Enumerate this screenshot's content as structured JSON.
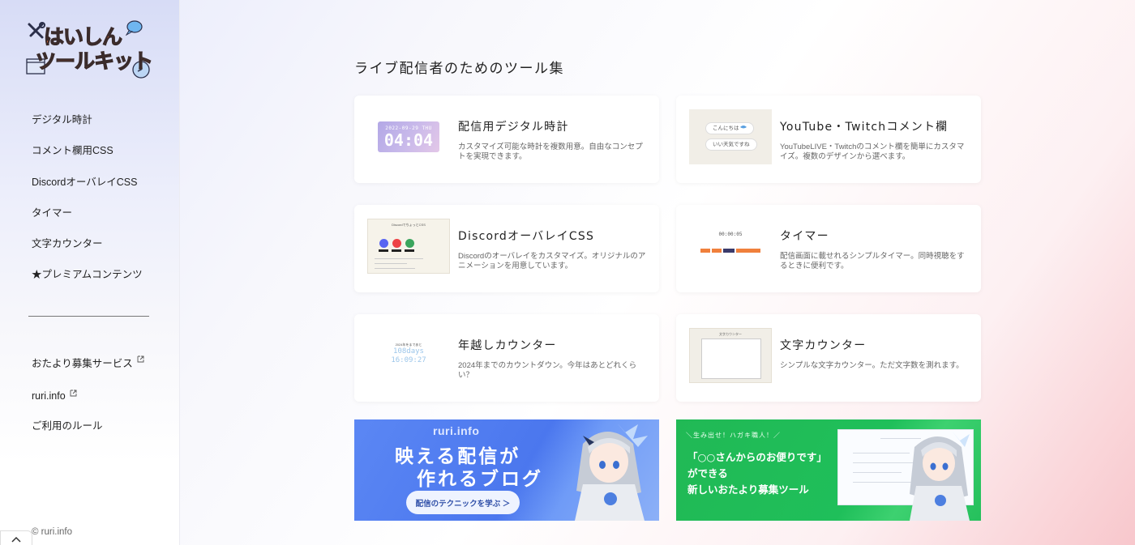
{
  "logo": {
    "line1": "はいしん",
    "line2": "ツールキット"
  },
  "sidebar": {
    "items": [
      {
        "label": "デジタル時計"
      },
      {
        "label": "コメント欄用CSS"
      },
      {
        "label": "DiscordオーバレイCSS"
      },
      {
        "label": "タイマー"
      },
      {
        "label": "文字カウンター"
      },
      {
        "label": "★プレミアムコンテンツ"
      }
    ],
    "external": [
      {
        "label": "おたより募集サービス",
        "icon": "external-link-icon"
      },
      {
        "label": "ruri.info",
        "icon": "external-link-icon"
      }
    ],
    "rules": "ご利用のルール",
    "copyright": "© ruri.info"
  },
  "main": {
    "title": "ライブ配信者のためのツール集",
    "cards": [
      {
        "title": "配信用デジタル時計",
        "desc": "カスタマイズ可能な時計を複数用意。自由なコンセプトを実現できます。",
        "thumb": {
          "date": "2022-09-29 THU",
          "time": "04:04"
        }
      },
      {
        "title": "YouTube・Twitchコメント欄",
        "desc": "YouTubeLIVE・Twitchのコメント欄を簡単にカスタマイズ。複数のデザインから選べます。",
        "thumb": {
          "pill1": "こんにちは",
          "pill2": "いい天気ですね"
        }
      },
      {
        "title": "DiscordオーバレイCSS",
        "desc": "Discordのオーバレイをカスタマイズ。オリジナルのアニメーションを用意しています。",
        "thumb": {
          "heading": "DiscordでちょっとCSS"
        }
      },
      {
        "title": "タイマー",
        "desc": "配信画面に載せれるシンプルタイマー。同時視聴をするときに便利です。",
        "thumb": {
          "time": "00:00:05"
        }
      },
      {
        "title": "年越しカウンター",
        "desc": "2024年までのカウントダウン。今年はあとどれくらい？",
        "thumb": {
          "caption": "2024年をまであと",
          "days": "108days",
          "time": "16:09:27"
        }
      },
      {
        "title": "文字カウンター",
        "desc": "シンプルな文字カウンター。ただ文字数を測れます。",
        "thumb": {
          "heading": "文字カウンター"
        }
      }
    ],
    "banners": [
      {
        "brand": "ruri.info",
        "headline1": "映える配信が",
        "headline2": "作れるブログ",
        "cta": "配信のテクニックを学ぶ ＞",
        "color": "#4b77ee"
      },
      {
        "tag": "＼生み出せ！ハガキ職人！／",
        "line1": "「○○さんからのお便りです」",
        "line2": "ができる",
        "line3": "新しいおたより募集ツール",
        "color": "#21b955"
      }
    ]
  },
  "colors": {
    "logo_orange": "#ef6d3a",
    "clock_gradient_start": "#b3a8e6",
    "countdown_blue": "#9cc6ea"
  }
}
